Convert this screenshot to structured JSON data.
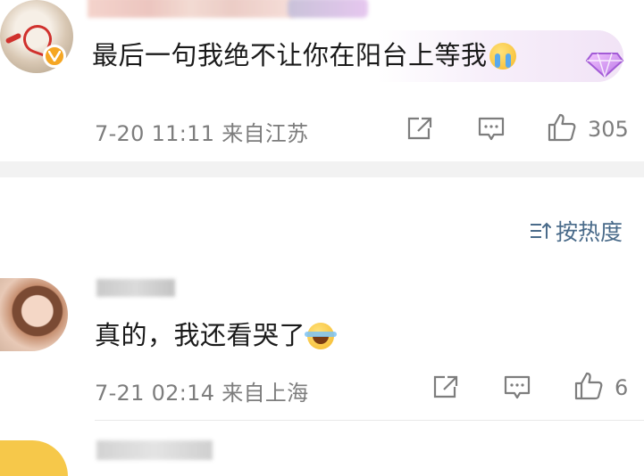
{
  "comment1": {
    "text": "最后一句我绝不让你在阳台上等我",
    "emoji": "crying-face-icon",
    "meta": "7-20 11:11  来自江苏",
    "likes": "305",
    "badge_color": "#f5a623"
  },
  "sort": {
    "label": "按热度",
    "icon": "sort-icon"
  },
  "comment2": {
    "text": "真的，我还看哭了",
    "emoji": "laughing-tears-icon",
    "meta": "7-21 02:14  来自上海",
    "likes": "6"
  },
  "colors": {
    "meta_gray": "#7d7d7d",
    "sort_blue": "#4a6b8a",
    "divider": "#f2f2f2"
  }
}
